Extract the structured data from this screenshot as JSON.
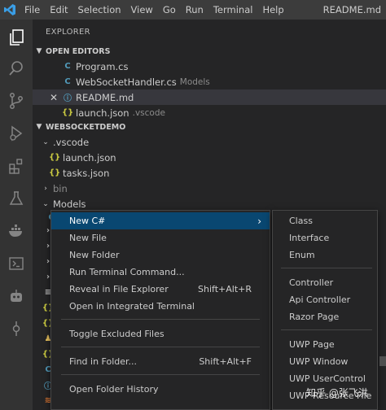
{
  "menubar": {
    "items": [
      "File",
      "Edit",
      "Selection",
      "View",
      "Go",
      "Run",
      "Terminal",
      "Help"
    ],
    "window_title": "README.md"
  },
  "activitybar": {
    "icons": [
      "files-icon",
      "search-icon",
      "source-control-icon",
      "run-debug-icon",
      "extensions-icon",
      "testing-icon",
      "docker-icon",
      "terminal-icon",
      "robot-icon",
      "git-commit-icon"
    ]
  },
  "sidebar": {
    "title": "EXPLORER",
    "open_editors": {
      "header": "OPEN EDITORS",
      "items": [
        {
          "name": "Program.cs",
          "desc": ""
        },
        {
          "name": "WebSocketHandler.cs",
          "desc": "Models"
        },
        {
          "name": "README.md",
          "desc": ""
        },
        {
          "name": "launch.json",
          "desc": ".vscode"
        }
      ]
    },
    "workspace": {
      "header": "WEBSOCKETDEMO",
      "items": [
        {
          "name": ".vscode"
        },
        {
          "name": "launch.json"
        },
        {
          "name": "tasks.json"
        },
        {
          "name": "bin"
        },
        {
          "name": "Models"
        }
      ]
    }
  },
  "context_menu": {
    "items": [
      {
        "label": "New C#",
        "shortcut": "",
        "submenu": true
      },
      {
        "label": "New File",
        "shortcut": ""
      },
      {
        "label": "New Folder",
        "shortcut": ""
      },
      {
        "label": "Run Terminal Command...",
        "shortcut": ""
      },
      {
        "label": "Reveal in File Explorer",
        "shortcut": "Shift+Alt+R"
      },
      {
        "label": "Open in Integrated Terminal",
        "shortcut": ""
      },
      {
        "label": "Toggle Excluded Files",
        "shortcut": ""
      },
      {
        "label": "Find in Folder...",
        "shortcut": "Shift+Alt+F"
      },
      {
        "label": "Open Folder History",
        "shortcut": ""
      }
    ]
  },
  "submenu": {
    "items": [
      "Class",
      "Interface",
      "Enum",
      "Controller",
      "Api Controller",
      "Razor Page",
      "UWP Page",
      "UWP Window",
      "UWP UserControl",
      "UWP Resource File"
    ]
  },
  "watermark": "知乎 @张飞洪",
  "colors": {
    "accent": "#007acc",
    "selection": "#094771",
    "json": "#cbcb41",
    "csharp": "#519aba"
  }
}
